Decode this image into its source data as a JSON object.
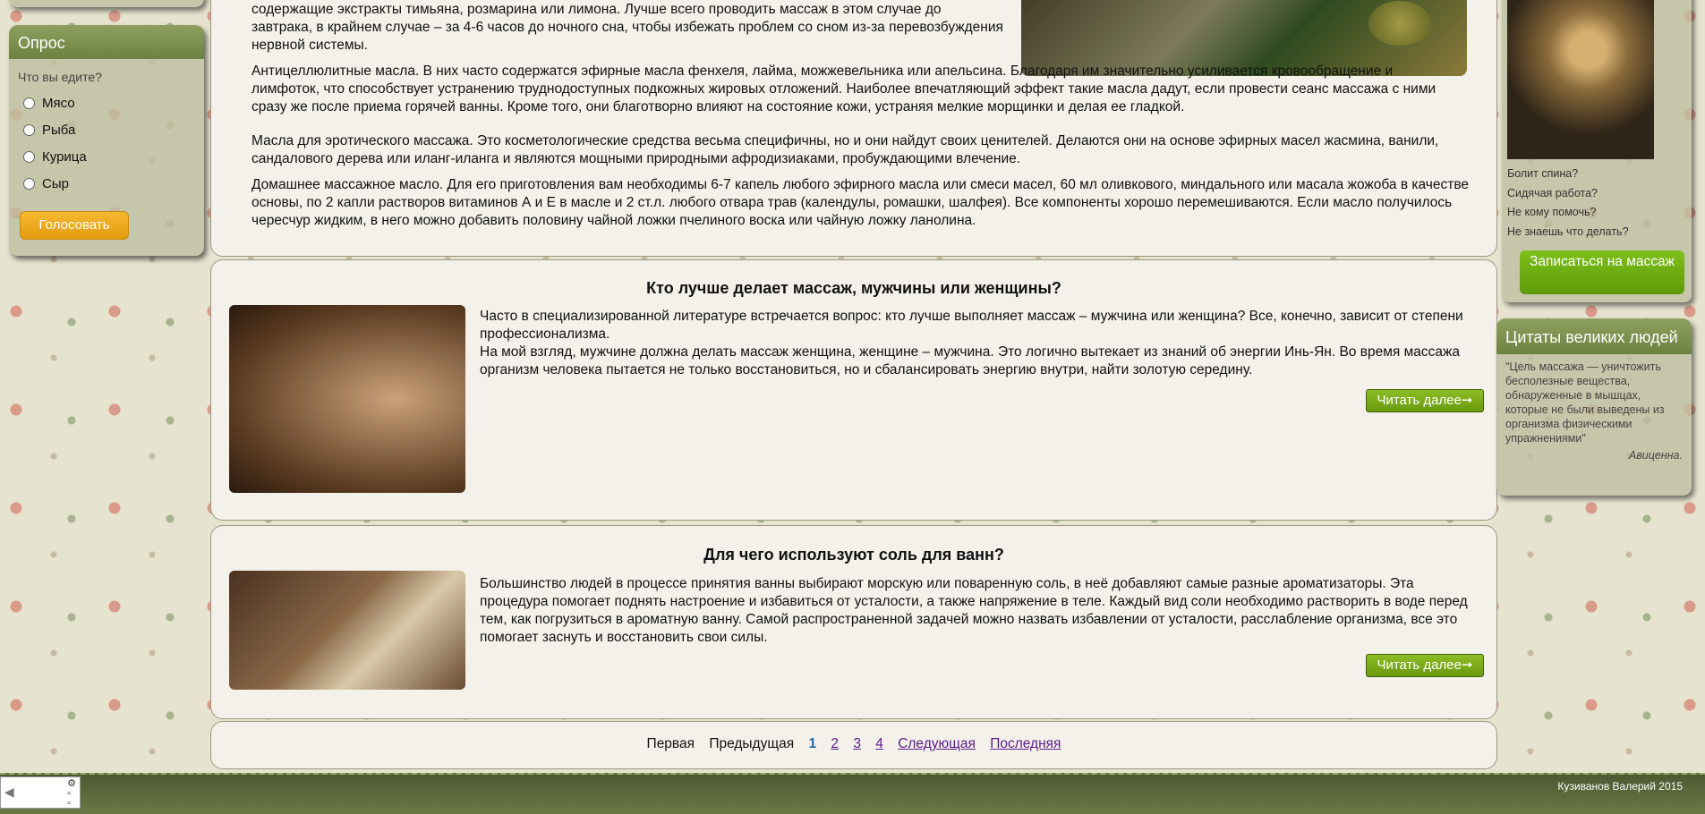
{
  "poll": {
    "title": "Опрос",
    "question": "Что вы едите?",
    "options": [
      "Мясо",
      "Рыба",
      "Курица",
      "Сыр"
    ],
    "vote_label": "Голосовать"
  },
  "article": {
    "paragraphs": [
      "содержащие экстракты тимьяна, розмарина или лимона. Лучше всего проводить массаж в этом случае до завтрака, в крайнем случае – за 4-6 часов до ночного сна, чтобы избежать проблем со сном из-за перевозбуждения нервной системы.",
      "Антицеллюлитные масла. В них часто содержатся эфирные масла фенхеля, лайма, можжевельника или апельсина. Благодаря им значительно усиливается кровообращение и лимфоток, что способствует устранению труднодоступных подкожных жировых отложений. Наиболее впечатляющий эффект такие масла дадут, если провести сеанс массажа с ними сразу же после приема горячей ванны. Кроме того, они благотворно влияют на состояние кожи, устраняя мелкие морщинки и делая ее гладкой.",
      "Масла для эротического массажа. Это косметологические средства весьма специфичны, но и они найдут своих ценителей. Делаются они на основе эфирных масел жасмина, ванили, сандалового дерева или иланг-иланга и являются мощными природными афродизиаками, пробуждающими влечение.",
      "Домашнее массажное масло. Для его приготовления вам необходимы 6-7 капель любого эфирного масла или смеси масел, 60 мл оливкового, миндального или масала жожоба в качестве основы, по 2 капли растворов витаминов А и Е в масле и 2 ст.л. любого отвара трав (календулы, ромашки, шалфея). Все компоненты хорошо перемешиваются. Если масло получилось чересчур жидким, в него можно добавить половину чайной ложки пчелиного воска или чайную ложку ланолина."
    ]
  },
  "posts": [
    {
      "title": "Кто лучше делает массаж, мужчины или женщины?",
      "text1": "Часто в специализированной литературе встречается вопрос: кто лучше выполняет массаж – мужчина или женщина? Все, конечно, зависит от степени профессионализма.",
      "text2": "На мой взгляд, мужчине должна делать массаж женщина, женщине – мужчина. Это логично вытекает из знаний об энергии Инь-Ян. Во время массажа организм человека пытается не только восстановиться, но и сбалансировать энергию внутри, найти золотую середину.",
      "read_more": "Читать далее➙"
    },
    {
      "title": "Для чего используют соль для ванн?",
      "text1": "Большинство людей в процессе принятия ванны выбирают морскую или поваренную соль, в неё добавляют самые разные ароматизаторы. Эта процедура помогает поднять настроение и избавиться от усталости, а также напряжение в теле. Каждый вид соли необходимо растворить в воде перед тем, как погрузиться в ароматную ванну. Самой распространенной задачей можно назвать избавлении от усталости, расслабление организма, все это помогает заснуть и восстановить свои силы.",
      "read_more": "Читать далее➙"
    }
  ],
  "pagination": {
    "first": "Первая",
    "prev": "Предыдущая",
    "pages": [
      "1",
      "2",
      "3",
      "4"
    ],
    "next": "Следующая",
    "last": "Последняя"
  },
  "ad": {
    "lines": [
      "Болит спина?",
      "Сидячая работа?",
      "Не кому помочь?",
      "Не знаешь что делать?"
    ],
    "button": "Записаться на массаж"
  },
  "quotes": {
    "title": "Цитаты великих людей",
    "text": "\"Цель массажа — уничтожить бесполезные вещества, обнаруженные в мышцах, которые не были выведены из организма физическими упражнениями\"",
    "author": "Авиценна."
  },
  "footer": {
    "copyright": "Кузиванов Валерий 2015"
  }
}
